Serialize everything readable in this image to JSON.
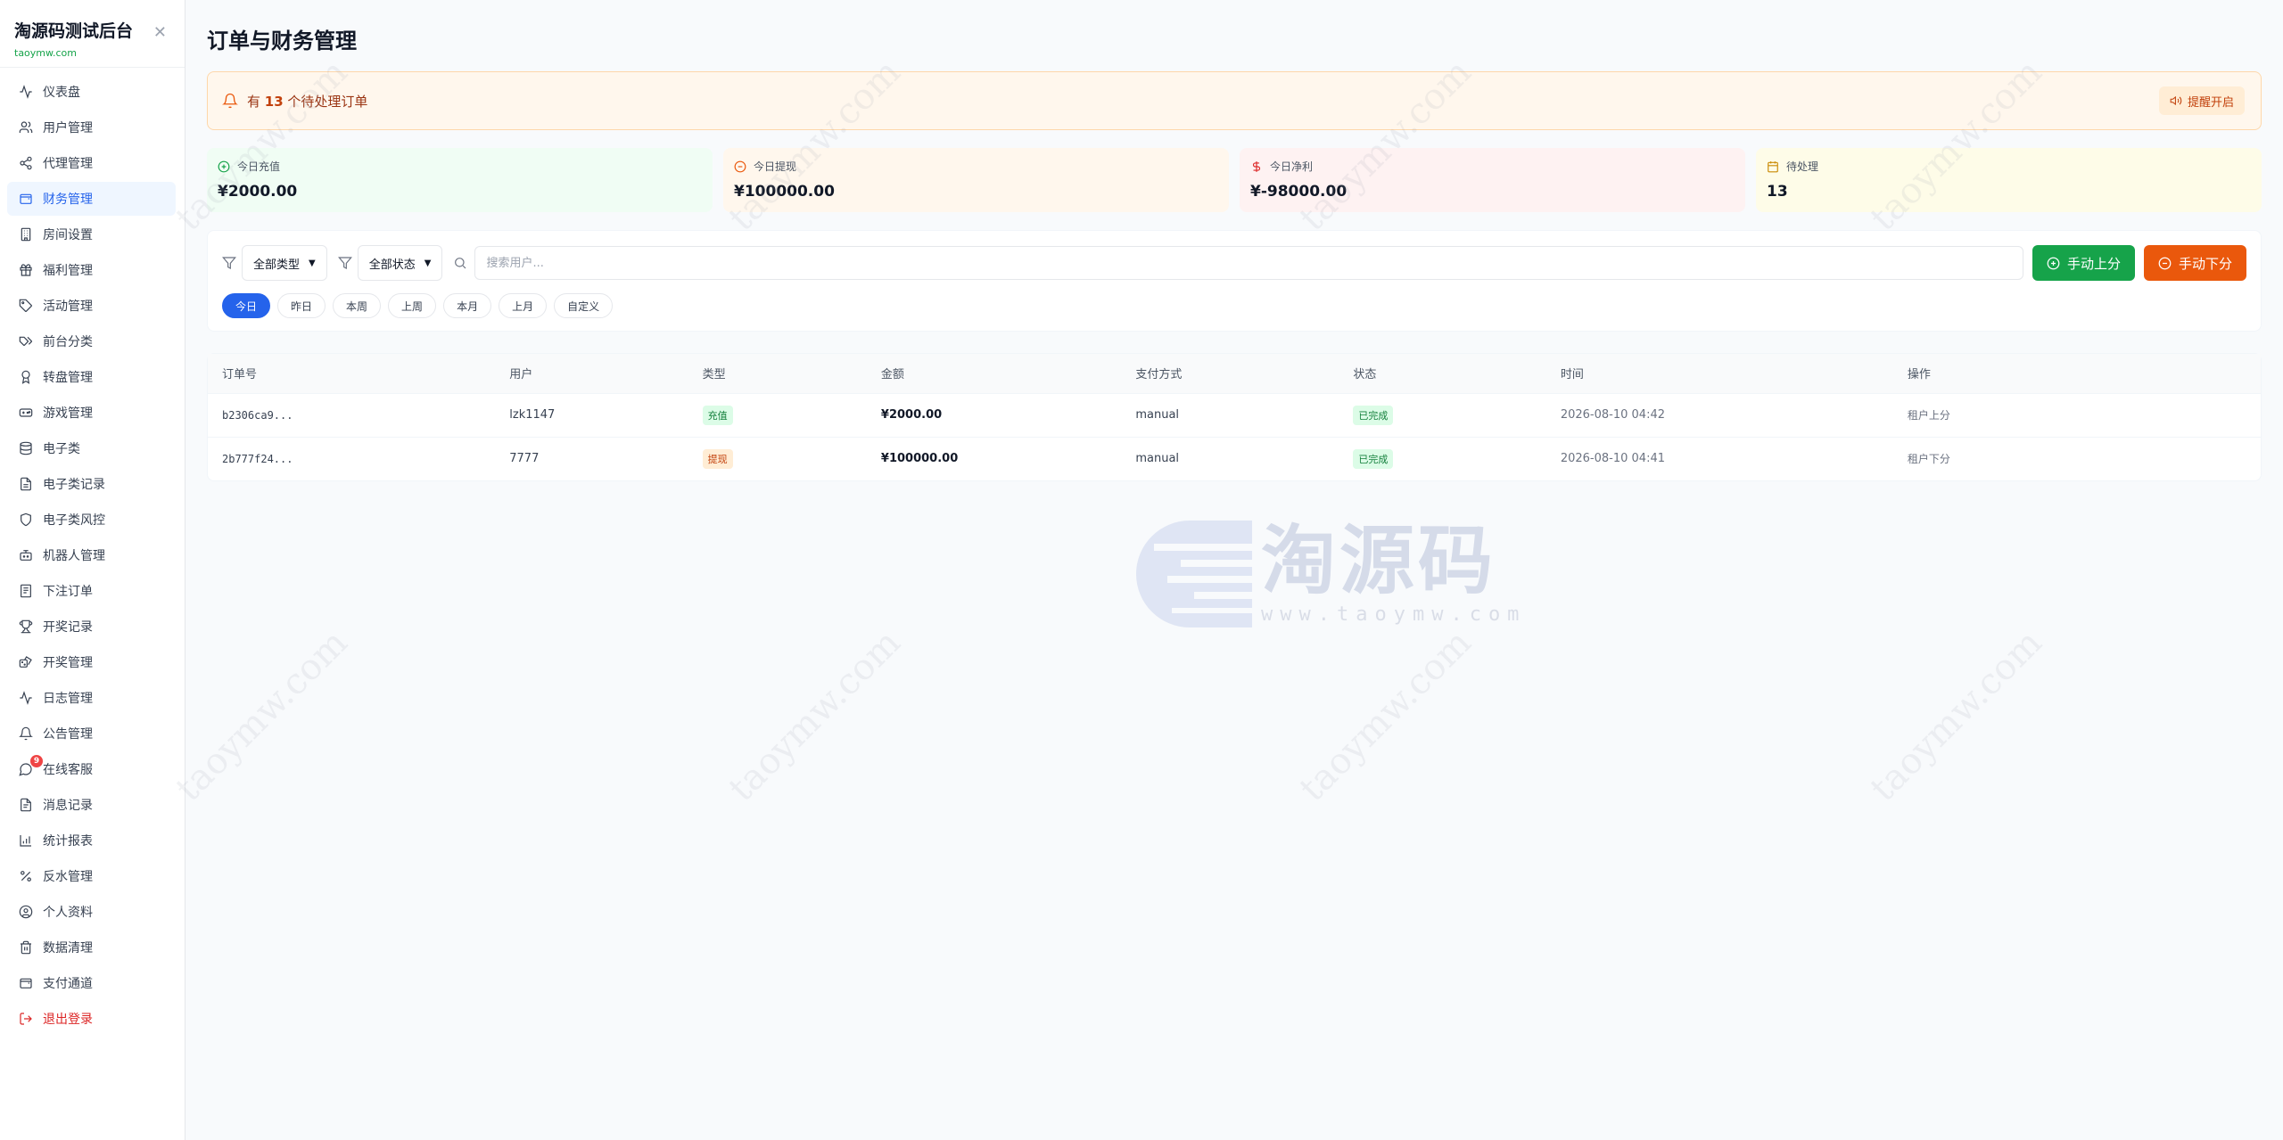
{
  "brand": {
    "title": "淘源码测试后台",
    "subtitle": "taoymw.com"
  },
  "sidebar": {
    "items": [
      {
        "label": "仪表盘",
        "icon": "activity-icon"
      },
      {
        "label": "用户管理",
        "icon": "users-icon"
      },
      {
        "label": "代理管理",
        "icon": "share-icon"
      },
      {
        "label": "财务管理",
        "icon": "wallet-icon",
        "active": true
      },
      {
        "label": "房间设置",
        "icon": "building-icon"
      },
      {
        "label": "福利管理",
        "icon": "gift-icon"
      },
      {
        "label": "活动管理",
        "icon": "tag-icon"
      },
      {
        "label": "前台分类",
        "icon": "tags-icon"
      },
      {
        "label": "转盘管理",
        "icon": "award-icon"
      },
      {
        "label": "游戏管理",
        "icon": "gamepad-icon"
      },
      {
        "label": "电子类",
        "icon": "database-icon"
      },
      {
        "label": "电子类记录",
        "icon": "file-icon"
      },
      {
        "label": "电子类风控",
        "icon": "shield-icon"
      },
      {
        "label": "机器人管理",
        "icon": "bot-icon"
      },
      {
        "label": "下注订单",
        "icon": "receipt-icon"
      },
      {
        "label": "开奖记录",
        "icon": "trophy-icon"
      },
      {
        "label": "开奖管理",
        "icon": "dice-icon"
      },
      {
        "label": "日志管理",
        "icon": "pulse-icon"
      },
      {
        "label": "公告管理",
        "icon": "bell-icon"
      },
      {
        "label": "在线客服",
        "icon": "chat-icon",
        "badge": "9"
      },
      {
        "label": "消息记录",
        "icon": "message-file-icon"
      },
      {
        "label": "统计报表",
        "icon": "bar-chart-icon"
      },
      {
        "label": "反水管理",
        "icon": "percent-icon"
      },
      {
        "label": "个人资料",
        "icon": "user-circle-icon"
      },
      {
        "label": "数据清理",
        "icon": "trash-icon"
      },
      {
        "label": "支付通道",
        "icon": "card-icon"
      },
      {
        "label": "退出登录",
        "icon": "logout-icon",
        "danger": true
      }
    ]
  },
  "page": {
    "title": "订单与财务管理"
  },
  "alert": {
    "prefix": "有 ",
    "count": "13",
    "suffix": " 个待处理订单",
    "button": "提醒开启"
  },
  "stats": [
    {
      "label": "今日充值",
      "value": "¥2000.00",
      "theme": "green",
      "icon": "plus-circle-icon"
    },
    {
      "label": "今日提现",
      "value": "¥100000.00",
      "theme": "orange",
      "icon": "minus-circle-icon"
    },
    {
      "label": "今日净利",
      "value": "¥-98000.00",
      "theme": "red",
      "icon": "dollar-icon"
    },
    {
      "label": "待处理",
      "value": "13",
      "theme": "yellow",
      "icon": "calendar-icon"
    }
  ],
  "filters": {
    "type_select": "全部类型",
    "status_select": "全部状态",
    "search_placeholder": "搜索用户...",
    "btn_add": "手动上分",
    "btn_sub": "手动下分",
    "date_chips": [
      "今日",
      "昨日",
      "本周",
      "上周",
      "本月",
      "上月",
      "自定义"
    ],
    "active_chip": "今日"
  },
  "table": {
    "headers": [
      "订单号",
      "用户",
      "类型",
      "金额",
      "支付方式",
      "状态",
      "时间",
      "操作"
    ],
    "rows": [
      {
        "order": "b2306ca9...",
        "user": "lzk1147",
        "type": "充值",
        "type_theme": "green",
        "amount": "¥2000.00",
        "method": "manual",
        "status": "已完成",
        "time": "2026-08-10 04:42",
        "op": "租户上分"
      },
      {
        "order": "2b777f24...",
        "user": "7777",
        "type": "提现",
        "type_theme": "orange",
        "amount": "¥100000.00",
        "method": "manual",
        "status": "已完成",
        "time": "2026-08-10 04:41",
        "op": "租户下分"
      }
    ]
  },
  "watermark": {
    "cn": "淘源码",
    "url": "www.taoymw.com",
    "diag": "taoymw.com"
  },
  "colors": {
    "primary": "#2563eb",
    "success": "#16a34a",
    "warning": "#ea580c",
    "danger": "#dc2626"
  }
}
